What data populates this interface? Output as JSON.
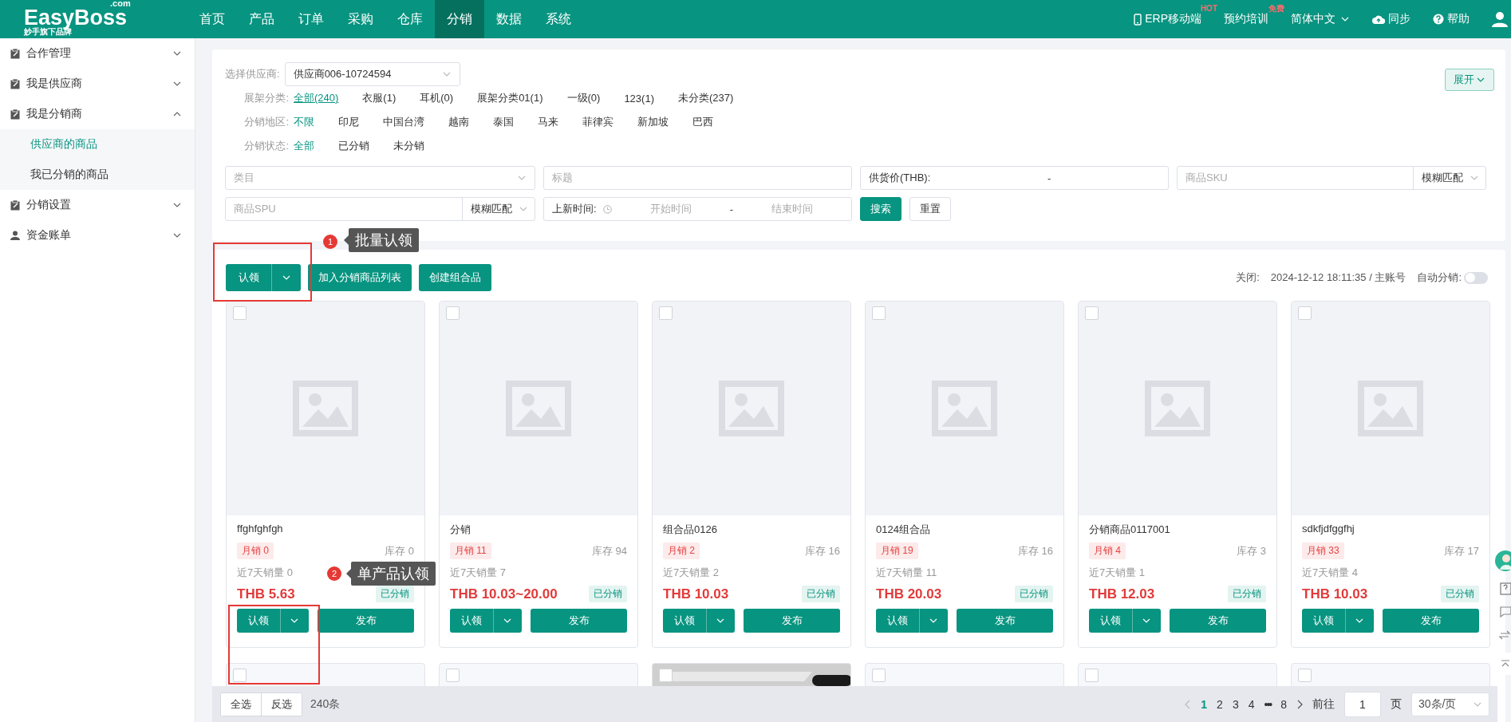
{
  "header": {
    "logo": "EasyBoss",
    "logo_suffix": ".com",
    "tagline": "妙手旗下品牌",
    "nav": [
      {
        "label": "首页",
        "selected": false
      },
      {
        "label": "产品",
        "selected": false
      },
      {
        "label": "订单",
        "selected": false
      },
      {
        "label": "采购",
        "selected": false
      },
      {
        "label": "仓库",
        "selected": false
      },
      {
        "label": "分销",
        "selected": true
      },
      {
        "label": "数据",
        "selected": false
      },
      {
        "label": "系统",
        "selected": false
      }
    ],
    "actions": [
      {
        "kind": "mobile",
        "label": "ERP移动端",
        "badge": "HOT"
      },
      {
        "kind": "training",
        "label": "预约培训",
        "badge": "免费"
      },
      {
        "kind": "language",
        "label": "简体中文"
      },
      {
        "kind": "sync",
        "label": "同步"
      },
      {
        "kind": "help",
        "label": "帮助"
      }
    ]
  },
  "sidebar": {
    "items": [
      {
        "kind": "section",
        "label": "合作管理",
        "expanded": false
      },
      {
        "kind": "section",
        "label": "我是供应商",
        "expanded": false
      },
      {
        "kind": "section",
        "label": "我是分销商",
        "expanded": true,
        "children": [
          {
            "label": "供应商的商品",
            "selected": true
          },
          {
            "label": "我已分销的商品",
            "selected": false
          }
        ]
      },
      {
        "kind": "section",
        "label": "分销设置",
        "expanded": false
      },
      {
        "kind": "account",
        "label": "资金账单",
        "expanded": false
      }
    ]
  },
  "filters": {
    "supplier": {
      "label": "选择供应商:",
      "value": "供应商006-10724594"
    },
    "expand_button": "展开",
    "groups": [
      {
        "label": "展架分类:",
        "options": [
          {
            "label": "全部(240)",
            "selected": true
          },
          {
            "label": "衣服(1)",
            "selected": false
          },
          {
            "label": "耳机(0)",
            "selected": false
          },
          {
            "label": "展架分类01(1)",
            "selected": false
          },
          {
            "label": "一级(0)",
            "selected": false
          },
          {
            "label": "123(1)",
            "selected": false
          },
          {
            "label": "未分类(237)",
            "selected": false
          }
        ]
      },
      {
        "label": "分销地区:",
        "options": [
          {
            "label": "不限",
            "selected": true
          },
          {
            "label": "印尼",
            "selected": false
          },
          {
            "label": "中国台湾",
            "selected": false
          },
          {
            "label": "越南",
            "selected": false
          },
          {
            "label": "泰国",
            "selected": false
          },
          {
            "label": "马来",
            "selected": false
          },
          {
            "label": "菲律宾",
            "selected": false
          },
          {
            "label": "新加坡",
            "selected": false
          },
          {
            "label": "巴西",
            "selected": false
          }
        ]
      },
      {
        "label": "分销状态:",
        "options": [
          {
            "label": "全部",
            "selected": true
          },
          {
            "label": "已分销",
            "selected": false
          },
          {
            "label": "未分销",
            "selected": false
          }
        ]
      }
    ],
    "fields": [
      {
        "kind": "select",
        "placeholder": "类目"
      },
      {
        "kind": "text",
        "placeholder": "标题"
      },
      {
        "kind": "range",
        "label": "供货价(THB):",
        "separator": "-"
      },
      {
        "kind": "match",
        "placeholder": "商品SKU",
        "match": "模糊匹配"
      },
      {
        "kind": "match",
        "placeholder": "商品SPU",
        "match": "模糊匹配"
      },
      {
        "kind": "date",
        "label": "上新时间:",
        "start_placeholder": "开始时间",
        "separator": "-",
        "end_placeholder": "结束时间"
      },
      {
        "kind": "primary",
        "label": "搜索"
      },
      {
        "kind": "plain",
        "label": "重置"
      }
    ]
  },
  "toolbar": {
    "claim": "认领",
    "buttons": [
      "加入分销商品列表",
      "创建组合品"
    ],
    "closed_label": "关闭:",
    "closed_info": "2024-12-12 18:11:35 / 主账号",
    "auto_label": "自动分销:",
    "auto_on": false
  },
  "products": [
    {
      "name": "ffghfghfgh",
      "monthly": "月销 0",
      "stock": "库存 0",
      "week": "近7天销量 0",
      "price": "THB 5.63",
      "status": "已分销",
      "claim": "认领",
      "publish": "发布",
      "checked": false
    },
    {
      "name": "分销",
      "monthly": "月销 11",
      "stock": "库存 94",
      "week": "近7天销量 7",
      "price": "THB 10.03~20.00",
      "status": "已分销",
      "claim": "认领",
      "publish": "发布",
      "checked": false
    },
    {
      "name": "组合品0126",
      "monthly": "月销 2",
      "stock": "库存 16",
      "week": "近7天销量 2",
      "price": "THB 10.03",
      "status": "已分销",
      "claim": "认领",
      "publish": "发布",
      "checked": false
    },
    {
      "name": "0124组合品",
      "monthly": "月销 19",
      "stock": "库存 16",
      "week": "近7天销量 11",
      "price": "THB 20.03",
      "status": "已分销",
      "claim": "认领",
      "publish": "发布",
      "checked": false
    },
    {
      "name": "分销商品0117001",
      "monthly": "月销 4",
      "stock": "库存 3",
      "week": "近7天销量 1",
      "price": "THB 12.03",
      "status": "已分销",
      "claim": "认领",
      "publish": "发布",
      "checked": false
    },
    {
      "name": "sdkfjdfggfhj",
      "monthly": "月销 33",
      "stock": "库存 17",
      "week": "近7天销量 4",
      "price": "THB 10.03",
      "status": "已分销",
      "claim": "认领",
      "publish": "发布",
      "checked": false
    }
  ],
  "more_products": [
    {
      "kind": "blank",
      "checked": false
    },
    {
      "kind": "blank",
      "checked": false
    },
    {
      "kind": "picture",
      "checked": false
    },
    {
      "kind": "blank",
      "checked": false
    },
    {
      "kind": "blank",
      "checked": false
    },
    {
      "kind": "blank",
      "checked": false
    }
  ],
  "footer": {
    "select_all": "全选",
    "invert": "反选",
    "count": "240条",
    "pages": [
      {
        "kind": "page",
        "label": "1",
        "selected": true
      },
      {
        "kind": "page",
        "label": "2",
        "selected": false
      },
      {
        "kind": "page",
        "label": "3",
        "selected": false
      },
      {
        "kind": "page",
        "label": "4",
        "selected": false
      },
      {
        "kind": "more",
        "label": "•••",
        "selected": false
      },
      {
        "kind": "page",
        "label": "8",
        "selected": false
      }
    ],
    "goto_label": "前往",
    "page_value": "1",
    "page_unit": "页",
    "page_size": "30条/页"
  },
  "annotations": [
    {
      "number": "1",
      "label": "批量认领"
    },
    {
      "number": "2",
      "label": "单产品认领"
    }
  ]
}
